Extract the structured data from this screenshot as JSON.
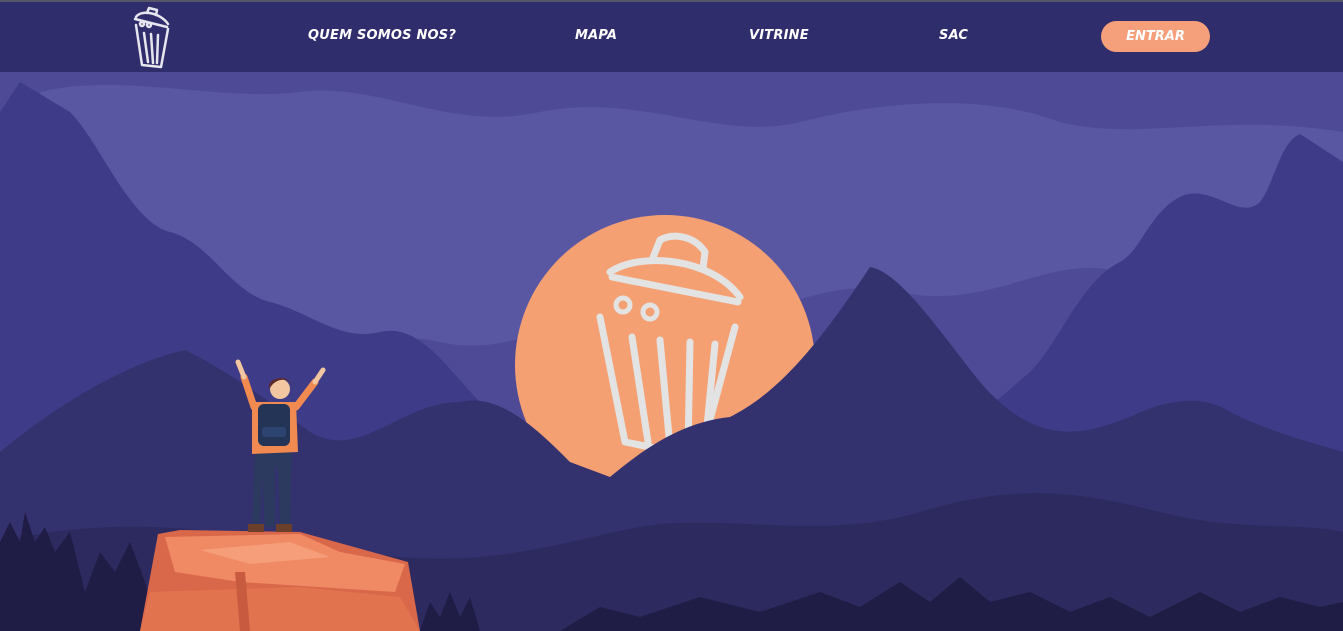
{
  "nav": {
    "logo_icon": "trash-can-icon",
    "links": [
      {
        "label": "QUEM SOMOS NOS?"
      },
      {
        "label": "MAPA"
      },
      {
        "label": "VITRINE"
      },
      {
        "label": "SAC"
      }
    ],
    "enter_label": "ENTRAR"
  },
  "hero": {
    "moon_icon": "trash-can-icon",
    "character": "hiker-with-raised-arms"
  },
  "colors": {
    "navbar": "#302d6d",
    "accent": "#f5a07a",
    "sky": "#4e4a96",
    "mountain_far": "#3f3d8a",
    "mountain_near": "#33306f",
    "cliff": "#e97a58"
  }
}
